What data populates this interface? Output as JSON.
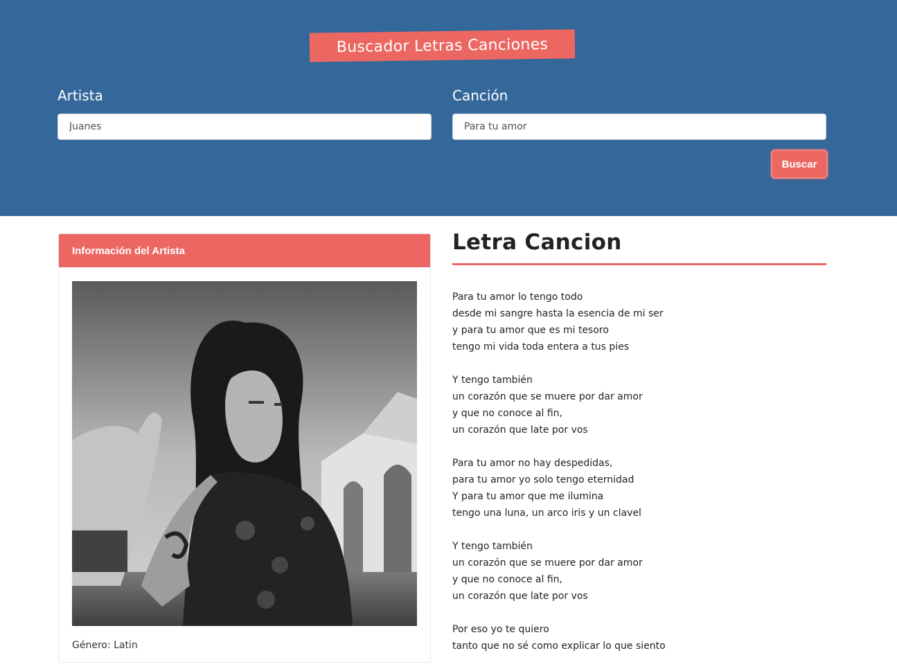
{
  "header": {
    "brand": "Buscador Letras Canciones",
    "artist_label": "Artista",
    "artist_value": "Juanes",
    "song_label": "Canción",
    "song_value": "Para tu amor",
    "search_button": "Buscar"
  },
  "artist_card": {
    "title": "Información del Artista",
    "genre": "Género: Latin"
  },
  "lyrics": {
    "title": "Letra Cancion",
    "stanzas": [
      [
        "Para tu amor lo tengo todo",
        "desde mi sangre hasta la esencia de mi ser",
        "y para tu amor que es mi tesoro",
        "tengo mi vida toda entera a tus pies"
      ],
      [
        "Y tengo también",
        "un corazón que se muere por dar amor",
        "y que no conoce al fin,",
        "un corazón que late por vos"
      ],
      [
        "Para tu amor no hay despedidas,",
        "para tu amor yo solo tengo eternidad",
        "Y para tu amor que me ilumina",
        "tengo una luna, un arco iris y un clavel"
      ],
      [
        "Y tengo también",
        "un corazón que se muere por dar amor",
        "y que no conoce al fin,",
        "un corazón que late por vos"
      ],
      [
        "Por eso yo te quiero",
        "tanto que no sé como explicar lo que siento"
      ]
    ]
  },
  "colors": {
    "header_bg": "#34679a",
    "accent": "#ec6762"
  }
}
